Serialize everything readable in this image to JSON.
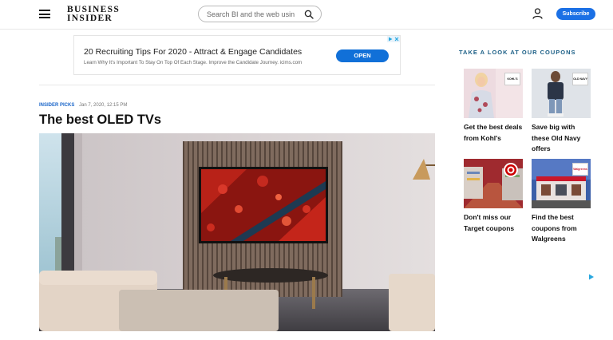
{
  "header": {
    "logo_line1": "BUSINESS",
    "logo_line2": "INSIDER",
    "search_placeholder": "Search BI and the web usin",
    "subscribe_label": "Subscribe"
  },
  "ad": {
    "title": "20 Recruiting Tips For 2020 - Attract & Engage Candidates",
    "description": "Learn Why It's Important To Stay On Top Of Each Stage. Improve the Candidate Journey. icims.com",
    "button_label": "OPEN"
  },
  "article": {
    "tag": "INSIDER PICKS",
    "date": "Jan 7, 2020, 12:15 PM",
    "headline": "The best OLED TVs"
  },
  "sidebar": {
    "heading": "TAKE A LOOK AT OUR COUPONS",
    "cards": [
      {
        "caption": "Get the best deals from Kohl's",
        "badge": "KOHL'S"
      },
      {
        "caption": "Save big with these Old Navy offers",
        "badge": "OLD NAVY"
      },
      {
        "caption": "Don't miss our Target coupons",
        "badge": ""
      },
      {
        "caption": "Find the best coupons from Walgreens",
        "badge": "Walgreens"
      }
    ]
  },
  "colors": {
    "accent": "#1b70e5",
    "kicker": "#1b66c9",
    "sidebar_heading": "#1b5f86"
  }
}
